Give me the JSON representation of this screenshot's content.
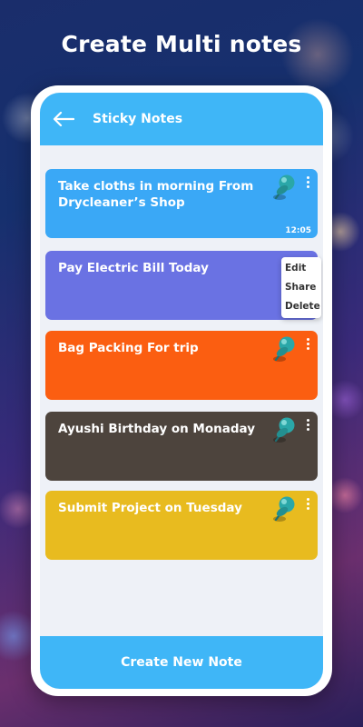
{
  "headline": "Create Multi notes",
  "app": {
    "title": "Sticky Notes",
    "back_icon": "arrow-left-icon",
    "accent": "#3fb6f7"
  },
  "notes": [
    {
      "text": "Take cloths in morning From Drycleaner’s Shop",
      "time": "12:05",
      "color": "#3aa8f6",
      "pin": true
    },
    {
      "text": "Pay Electric Bill Today",
      "time": "",
      "color": "#6a72e3",
      "pin": false
    },
    {
      "text": "Bag Packing For trip",
      "time": "",
      "color": "#fb5e11",
      "pin": true
    },
    {
      "text": "Ayushi Birthday on Monaday",
      "time": "",
      "color": "#4d443d",
      "pin": true
    },
    {
      "text": "Submit Project on Tuesday",
      "time": "",
      "color": "#e8bb1f",
      "pin": true
    }
  ],
  "context_menu": {
    "items": [
      "Edit",
      "Share",
      "Delete"
    ]
  },
  "create_button": "Create New Note"
}
